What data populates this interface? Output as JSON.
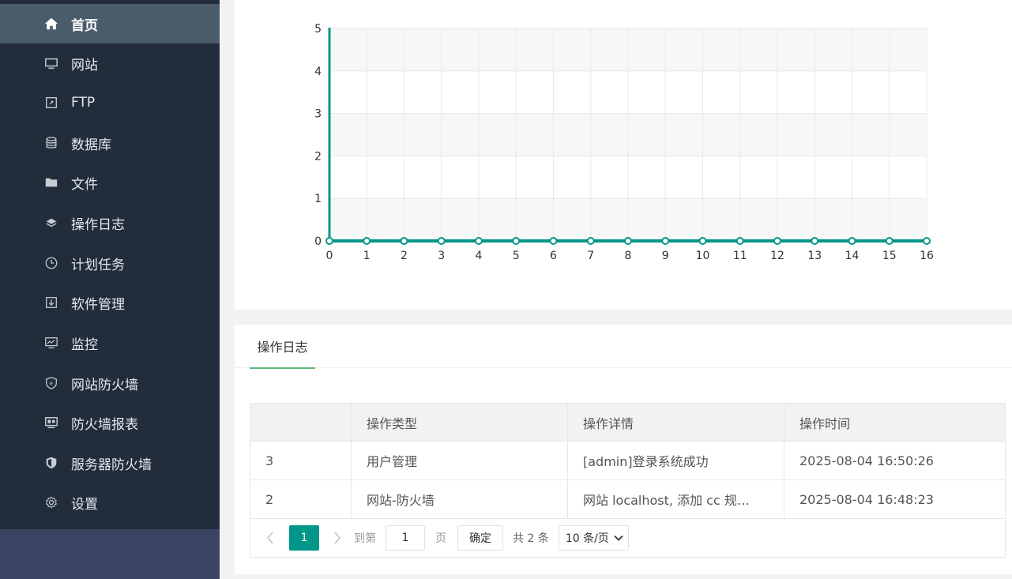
{
  "sidebar": {
    "items": [
      {
        "label": "首页",
        "icon": "home-icon",
        "active": true
      },
      {
        "label": "网站",
        "icon": "monitor-icon"
      },
      {
        "label": "FTP",
        "icon": "ftp-file-icon"
      },
      {
        "label": "数据库",
        "icon": "database-icon"
      },
      {
        "label": "文件",
        "icon": "folder-icon"
      },
      {
        "label": "操作日志",
        "icon": "layers-icon"
      },
      {
        "label": "计划任务",
        "icon": "clock-icon"
      },
      {
        "label": "软件管理",
        "icon": "download-box-icon"
      },
      {
        "label": "监控",
        "icon": "chart-monitor-icon"
      },
      {
        "label": "网站防火墙",
        "icon": "shield-e-icon"
      },
      {
        "label": "防火墙报表",
        "icon": "report-screen-icon"
      },
      {
        "label": "服务器防火墙",
        "icon": "shield-icon"
      },
      {
        "label": "设置",
        "icon": "gear-icon"
      }
    ]
  },
  "chart_data": {
    "type": "line",
    "x": [
      0,
      1,
      2,
      3,
      4,
      5,
      6,
      7,
      8,
      9,
      10,
      11,
      12,
      13,
      14,
      15,
      16
    ],
    "series": [
      {
        "values": [
          0,
          0,
          0,
          0,
          0,
          0,
          0,
          0,
          0,
          0,
          0,
          0,
          0,
          0,
          0,
          0,
          0
        ],
        "color": "#009688"
      }
    ],
    "xlim": [
      0,
      16
    ],
    "ylim": [
      0,
      5
    ],
    "yticks": [
      0,
      1,
      2,
      3,
      4,
      5
    ],
    "xticks": [
      0,
      1,
      2,
      3,
      4,
      5,
      6,
      7,
      8,
      9,
      10,
      11,
      12,
      13,
      14,
      15,
      16
    ],
    "grid": true
  },
  "log": {
    "tab_label": "操作日志",
    "columns": [
      "",
      "操作类型",
      "操作详情",
      "操作时间"
    ],
    "rows": [
      {
        "id": "3",
        "type": "用户管理",
        "detail": "[admin]登录系统成功",
        "time": "2025-08-04 16:50:26"
      },
      {
        "id": "2",
        "type": "网站-防火墙",
        "detail": "网站 localhost, 添加 cc 规…",
        "time": "2025-08-04 16:48:23"
      }
    ],
    "pager": {
      "current": "1",
      "goto_label": "到第",
      "goto_value": "1",
      "page_label": "页",
      "confirm_label": "确定",
      "total_label": "共 2 条",
      "page_size": "10 条/页"
    }
  },
  "colors": {
    "sidebar_bg": "#222d3c",
    "active_item_bg": "#4a5b6b",
    "accent": "#009688",
    "tab_underline": "#5fb878"
  }
}
